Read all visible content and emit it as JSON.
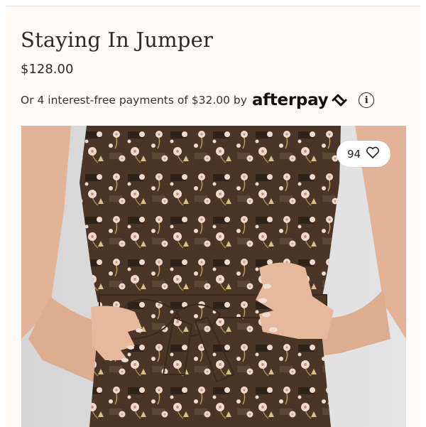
{
  "product": {
    "title": "Staying In Jumper",
    "price": "$128.00"
  },
  "payment": {
    "text": "Or 4 interest-free payments of $32.00 by",
    "provider": "afterpay",
    "info_glyph": "i"
  },
  "image": {
    "description_icon": "product-photo",
    "like_count": "94",
    "like_icon": "heart-outline-icon"
  },
  "colors": {
    "background": "#fdfaf7",
    "text": "#2a2a2a",
    "print_base": "#4a3526",
    "flower": "#f0d9cf"
  }
}
